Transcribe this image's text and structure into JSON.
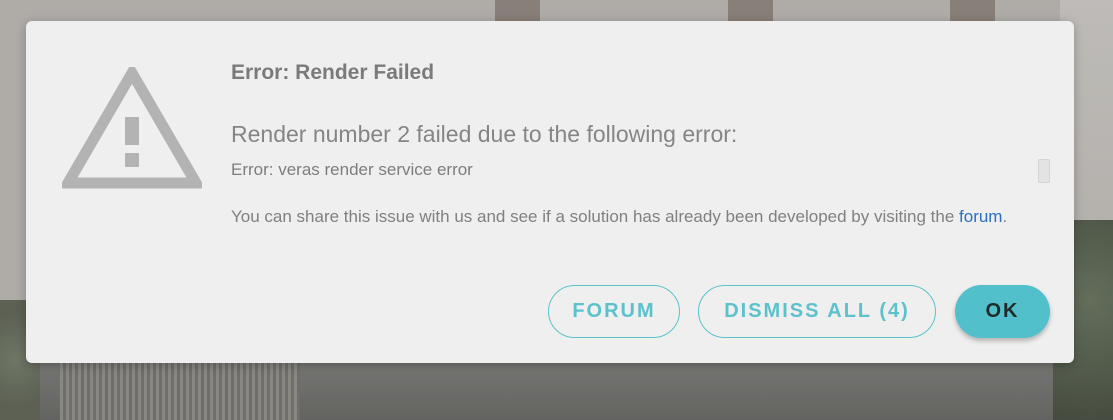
{
  "dialog": {
    "title": "Error: Render Failed",
    "message_heading": "Render number 2 failed due to the following error:",
    "error_detail": "Error: veras render service error",
    "share_text_before": "You can share this issue with us and see if a solution has already been developed by visiting the ",
    "share_link_label": "forum",
    "share_text_after": ".",
    "icon": "warning-triangle-icon"
  },
  "buttons": {
    "forum_label": "FORUM",
    "dismiss_all_label": "DISMISS ALL (4)",
    "ok_label": "OK"
  },
  "colors": {
    "accent": "#52c0cb",
    "link": "#2a6fc2",
    "icon": "#b3b3b3",
    "dialog_bg": "#efefef"
  }
}
